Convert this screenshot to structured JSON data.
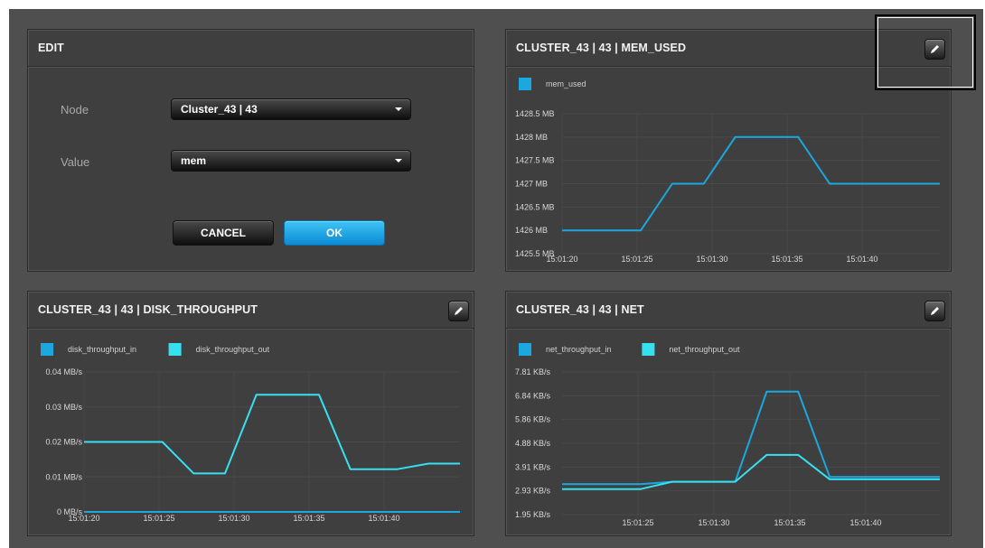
{
  "colors": {
    "series_blue": "#1ba8e0",
    "series_cyan": "#37e0f0",
    "panel_bg": "#3f3f3f",
    "canvas_bg": "#4f4f4f",
    "ok_button": "#1da7e8"
  },
  "edit_panel": {
    "title": "EDIT",
    "node_label": "Node",
    "node_value": "Cluster_43 | 43",
    "value_label": "Value",
    "value_value": "mem",
    "cancel_label": "CANCEL",
    "ok_label": "OK"
  },
  "icons": {
    "edit": "pencil-icon",
    "dropdown": "chevron-down-icon"
  },
  "chart_data": [
    {
      "id": "mem",
      "type": "line",
      "title": "CLUSTER_43 | 43 | MEM_USED",
      "y_ticks": [
        "1428.5 MB",
        "1428 MB",
        "1427.5 MB",
        "1427 MB",
        "1426.5 MB",
        "1426 MB",
        "1425.5 MB"
      ],
      "ylim": [
        1425.5,
        1428.5
      ],
      "x_ticks": [
        "15:01:20",
        "15:01:25",
        "15:01:30",
        "15:01:35",
        "15:01:40"
      ],
      "xlim": [
        20,
        44
      ],
      "series": [
        {
          "name": "mem_used",
          "color": "#1ba8e0",
          "x": [
            20,
            25,
            27,
            29,
            31,
            35,
            37,
            44
          ],
          "y": [
            1426,
            1426,
            1427,
            1427,
            1428,
            1428,
            1427,
            1427
          ]
        }
      ]
    },
    {
      "id": "disk",
      "type": "line",
      "title": "CLUSTER_43 | 43 | DISK_THROUGHPUT",
      "y_ticks": [
        "0.04 MB/s",
        "0.03 MB/s",
        "0.02 MB/s",
        "0.01 MB/s",
        "0 MB/s"
      ],
      "ylim": [
        0,
        0.04
      ],
      "x_ticks": [
        "15:01:20",
        "15:01:25",
        "15:01:30",
        "15:01:35",
        "15:01:40"
      ],
      "xlim": [
        20,
        44
      ],
      "series": [
        {
          "name": "disk_throughput_in",
          "color": "#1ba8e0",
          "x": [
            20,
            44
          ],
          "y": [
            0,
            0
          ]
        },
        {
          "name": "disk_throughput_out",
          "color": "#37e0f0",
          "x": [
            20,
            25,
            27,
            29,
            31,
            35,
            37,
            40,
            42,
            44
          ],
          "y": [
            0.02,
            0.02,
            0.011,
            0.011,
            0.0335,
            0.0335,
            0.0122,
            0.0122,
            0.0138,
            0.0138
          ]
        }
      ]
    },
    {
      "id": "net",
      "type": "line",
      "title": "CLUSTER_43 | 43 | NET",
      "y_ticks": [
        "7.81 KB/s",
        "6.84 KB/s",
        "5.86 KB/s",
        "4.88 KB/s",
        "3.91 KB/s",
        "2.93 KB/s",
        "1.95 KB/s"
      ],
      "ylim": [
        1.95,
        7.81
      ],
      "x_ticks": [
        "15:01:25",
        "15:01:30",
        "15:01:35",
        "15:01:40"
      ],
      "xlim": [
        20,
        44
      ],
      "series": [
        {
          "name": "net_throughput_in",
          "color": "#1ba8e0",
          "x": [
            20,
            25,
            27,
            31,
            33,
            35,
            37,
            44
          ],
          "y": [
            3.2,
            3.2,
            3.3,
            3.3,
            7.0,
            7.0,
            3.5,
            3.5
          ]
        },
        {
          "name": "net_throughput_out",
          "color": "#37e0f0",
          "x": [
            20,
            25,
            27,
            31,
            33,
            35,
            37,
            44
          ],
          "y": [
            3.0,
            3.0,
            3.3,
            3.3,
            4.4,
            4.4,
            3.4,
            3.4
          ]
        }
      ]
    }
  ]
}
